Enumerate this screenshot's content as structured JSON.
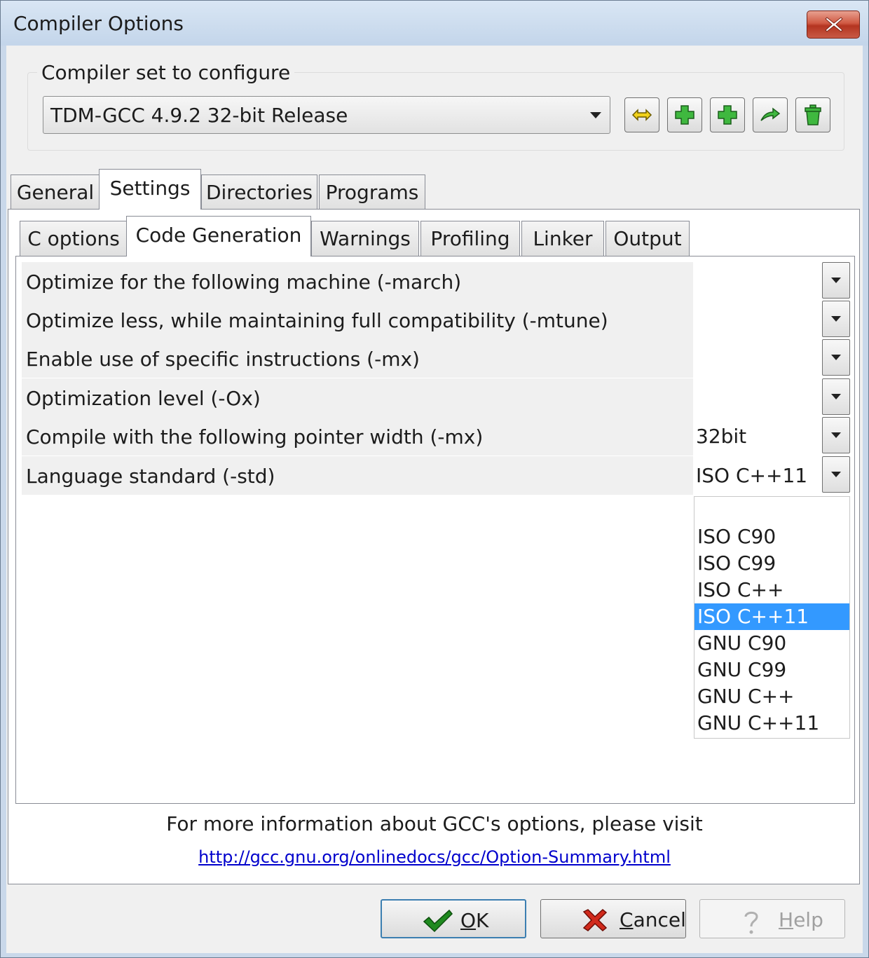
{
  "window": {
    "title": "Compiler Options"
  },
  "compiler_set": {
    "group_label": "Compiler set to configure",
    "selected": "TDM-GCC 4.9.2 32-bit Release",
    "toolbar_icons": [
      "rename-icon",
      "add-blank-icon",
      "add-folder-icon",
      "find-icon",
      "delete-icon"
    ]
  },
  "tabs": [
    "General",
    "Settings",
    "Directories",
    "Programs"
  ],
  "active_tab": "Settings",
  "subtabs": [
    "C options",
    "Code Generation",
    "Warnings",
    "Profiling",
    "Linker",
    "Output"
  ],
  "active_subtab": "Code Generation",
  "options": [
    {
      "label": "Optimize for the following machine (-march)",
      "value": ""
    },
    {
      "label": "Optimize less, while maintaining full compatibility (-mtune)",
      "value": ""
    },
    {
      "label": "Enable use of specific instructions (-mx)",
      "value": ""
    },
    {
      "label": "Optimization level (-Ox)",
      "value": ""
    },
    {
      "label": "Compile with the following pointer width (-mx)",
      "value": "32bit"
    },
    {
      "label": "Language standard (-std)",
      "value": "ISO C++11"
    }
  ],
  "dropdown": {
    "options": [
      "",
      "ISO C90",
      "ISO C99",
      "ISO C++",
      "ISO C++11",
      "GNU C90",
      "GNU C99",
      "GNU C++",
      "GNU C++11"
    ],
    "selected": "ISO C++11"
  },
  "info": {
    "text": "For more information about GCC's options, please visit",
    "link": "http://gcc.gnu.org/onlinedocs/gcc/Option-Summary.html"
  },
  "buttons": {
    "ok": {
      "label": "OK",
      "accel": "O",
      "rest": "K"
    },
    "cancel": {
      "label": "Cancel",
      "accel": "C",
      "rest": "ancel"
    },
    "help": {
      "label": "Help",
      "accel": "H",
      "rest": "elp"
    }
  },
  "colors": {
    "selection": "#3399ff",
    "link": "#0000cc",
    "titlebar": "#c9d8ea",
    "close": "#c8442f"
  }
}
